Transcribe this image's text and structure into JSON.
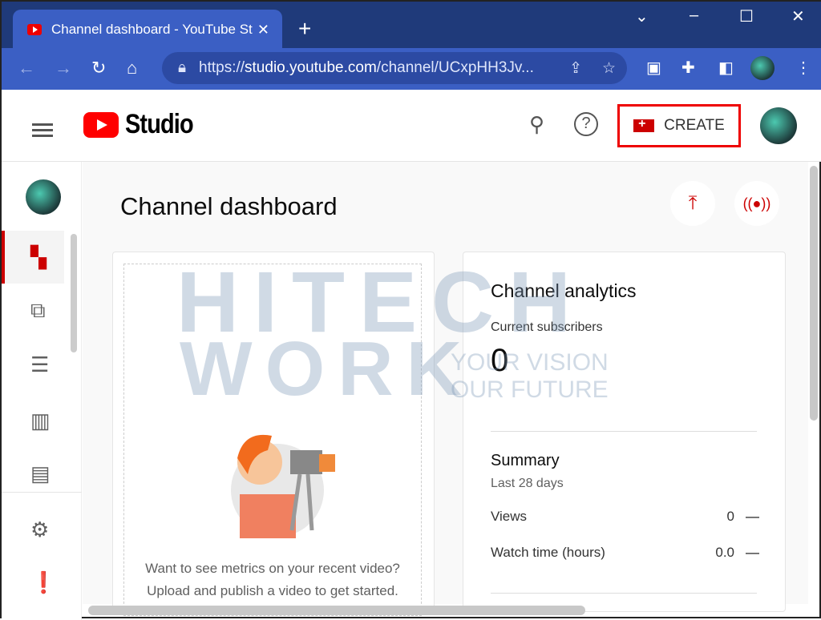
{
  "browser": {
    "tab_title": "Channel dashboard - YouTube St",
    "url_prefix": "https://",
    "url_host": "studio.youtube.com",
    "url_path": "/channel/UCxpHH3Jv..."
  },
  "header": {
    "logo_text": "Studio",
    "create_label": "CREATE"
  },
  "page": {
    "title": "Channel dashboard"
  },
  "video_card": {
    "line1": "Want to see metrics on your recent video?",
    "line2": "Upload and publish a video to get started."
  },
  "analytics": {
    "title": "Channel analytics",
    "subs_label": "Current subscribers",
    "subs_value": "0",
    "summary_title": "Summary",
    "summary_period": "Last 28 days",
    "rows": [
      {
        "label": "Views",
        "value": "0",
        "trend": "—"
      },
      {
        "label": "Watch time (hours)",
        "value": "0.0",
        "trend": "—"
      }
    ]
  },
  "watermark": {
    "line1": "HITECH",
    "line2": "WORK",
    "tag1": "YOUR VISION",
    "tag2": "OUR FUTURE"
  },
  "colors": {
    "accent": "#ff0000",
    "browser": "#3b5fc4"
  }
}
